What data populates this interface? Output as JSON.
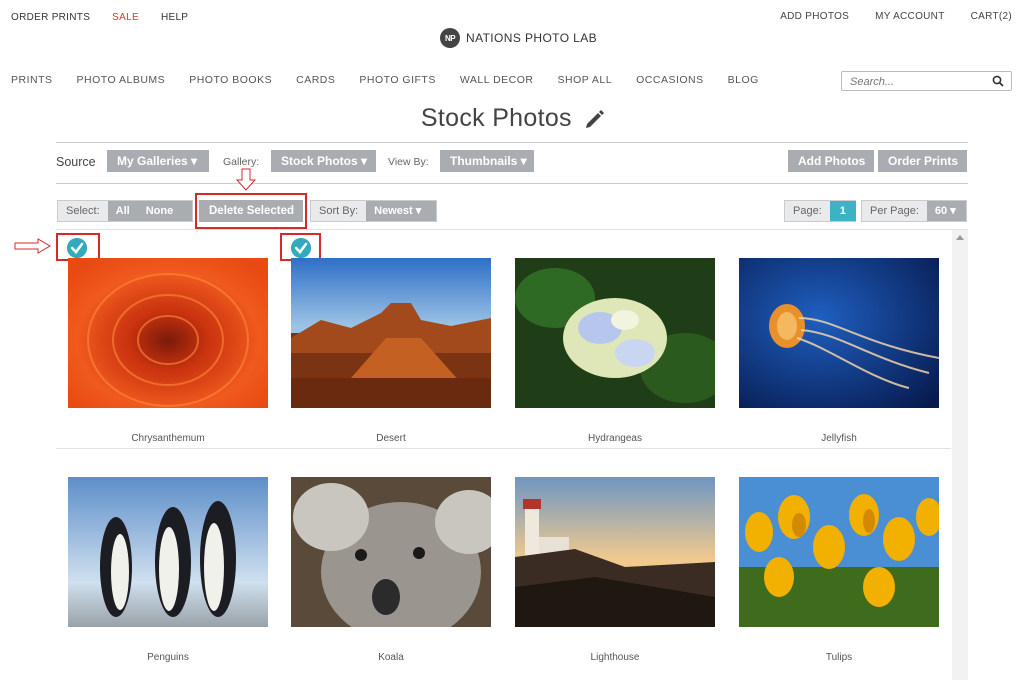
{
  "topbar": {
    "left": [
      "ORDER PRINTS",
      "SALE",
      "HELP"
    ],
    "right": [
      "ADD PHOTOS",
      "MY ACCOUNT",
      "CART(2)"
    ]
  },
  "logo": {
    "mark": "NP",
    "name": "NATIONS PHOTO LAB"
  },
  "mainnav": [
    "PRINTS",
    "PHOTO ALBUMS",
    "PHOTO BOOKS",
    "CARDS",
    "PHOTO GIFTS",
    "WALL DECOR",
    "SHOP ALL",
    "OCCASIONS",
    "BLOG"
  ],
  "search": {
    "placeholder": "Search..."
  },
  "page": {
    "title": "Stock Photos"
  },
  "toolbar": {
    "source_label": "Source",
    "source_value": "My Galleries",
    "gallery_label": "Gallery:",
    "gallery_value": "Stock Photos",
    "viewby_label": "View By:",
    "viewby_value": "Thumbnails",
    "add_photos": "Add Photos",
    "order_prints": "Order Prints"
  },
  "selectbar": {
    "select_label": "Select:",
    "all": "All",
    "none": "None",
    "delete_selected": "Delete Selected",
    "sortby_label": "Sort By:",
    "sortby_value": "Newest",
    "page_label": "Page:",
    "page_value": "1",
    "perpage_label": "Per Page:",
    "perpage_value": "60"
  },
  "colors": {
    "accent": "#33a9bd",
    "button_gray": "#a9acb1",
    "highlight_red": "#d42a2a",
    "sale_red": "#d9372b"
  },
  "photos": [
    {
      "caption": "Chrysanthemum",
      "selected": true
    },
    {
      "caption": "Desert",
      "selected": true
    },
    {
      "caption": "Hydrangeas",
      "selected": false
    },
    {
      "caption": "Jellyfish",
      "selected": false
    },
    {
      "caption": "Penguins",
      "selected": false
    },
    {
      "caption": "Koala",
      "selected": false
    },
    {
      "caption": "Lighthouse",
      "selected": false
    },
    {
      "caption": "Tulips",
      "selected": false
    }
  ]
}
